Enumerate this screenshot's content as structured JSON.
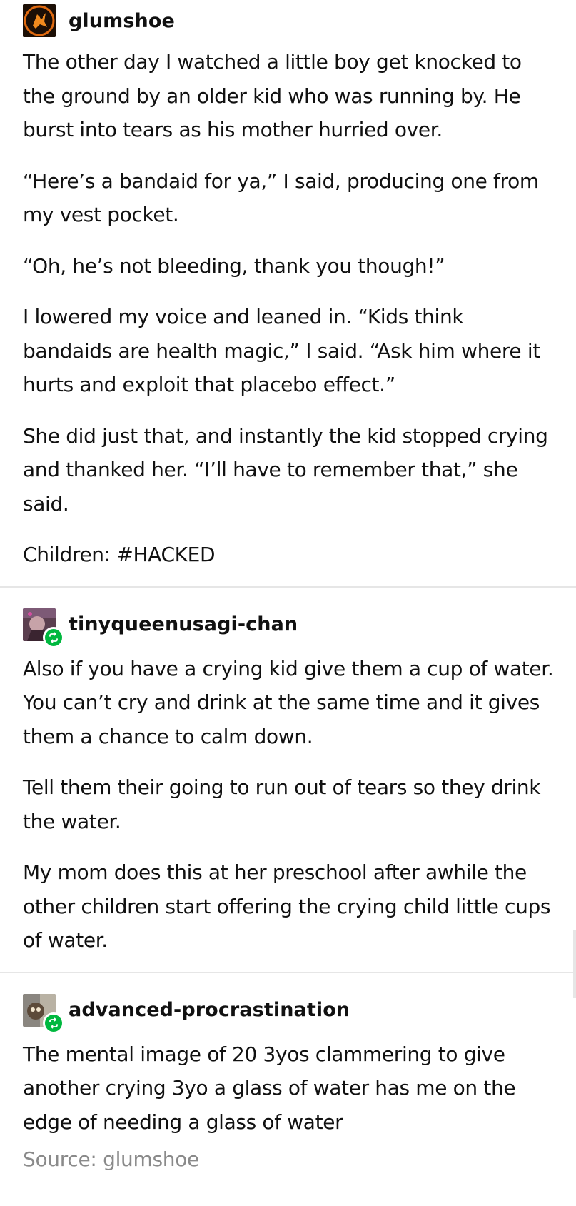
{
  "posts": [
    {
      "username": "glumshoe",
      "paragraphs": [
        "The other day I watched a little boy get knocked to the ground by an older kid who was running by. He burst into tears as his mother hurried over.",
        "“Here’s a bandaid for ya,” I said, producing one from my vest pocket.",
        "“Oh, he’s not bleeding, thank you though!”",
        "I lowered my voice and leaned in. “Kids think bandaids are health magic,” I said. “Ask him where it hurts and exploit that placebo effect.”",
        "She did just that, and instantly the kid stopped crying and thanked her. “I’ll have to remember that,” she said.",
        "Children: #HACKED"
      ]
    },
    {
      "username": "tinyqueenusagi-chan",
      "paragraphs": [
        "Also if you have a crying kid give them a cup of water. You can’t cry and drink at the same time and it gives them a chance to calm down.",
        "Tell them their going to run out of tears so they drink the water.",
        "My mom does this at her preschool after awhile the other children start offering the crying child little cups of water."
      ]
    },
    {
      "username": "advanced-procrastination",
      "paragraphs": [
        "The mental image of 20 3yos clammering to give another crying 3yo a glass of water has me on the edge of needing a glass of water"
      ]
    }
  ],
  "source": "Source: glumshoe",
  "colors": {
    "reblog_badge": "#00b83f",
    "divider": "#e6e6e6",
    "source_text": "#8a8a8a"
  }
}
